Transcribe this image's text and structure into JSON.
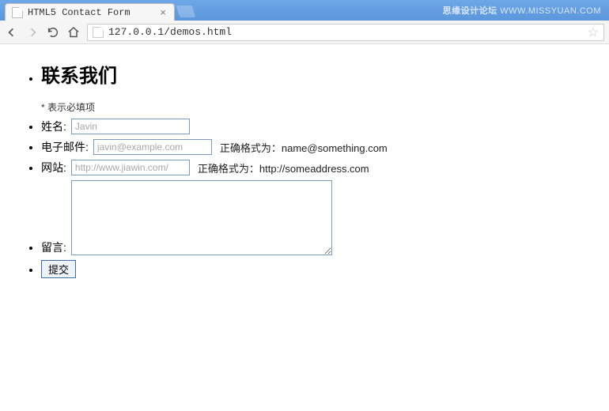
{
  "browser": {
    "tab_title": "HTML5 Contact Form",
    "url": "127.0.0.1/demos.html",
    "watermark_cn": "思缘设计论坛",
    "watermark_en": "WWW.MISSYUAN.COM"
  },
  "page": {
    "heading": "联系我们",
    "required_note": "* 表示必填项",
    "fields": {
      "name": {
        "label": "姓名:",
        "placeholder": "Javin"
      },
      "email": {
        "label": "电子邮件:",
        "placeholder": "javin@example.com",
        "hint": "正确格式为：name@something.com"
      },
      "website": {
        "label": "网站:",
        "placeholder": "http://www.jiawin.com/",
        "hint": "正确格式为：http://someaddress.com"
      },
      "message": {
        "label": "留言:"
      }
    },
    "submit_label": "提交"
  }
}
